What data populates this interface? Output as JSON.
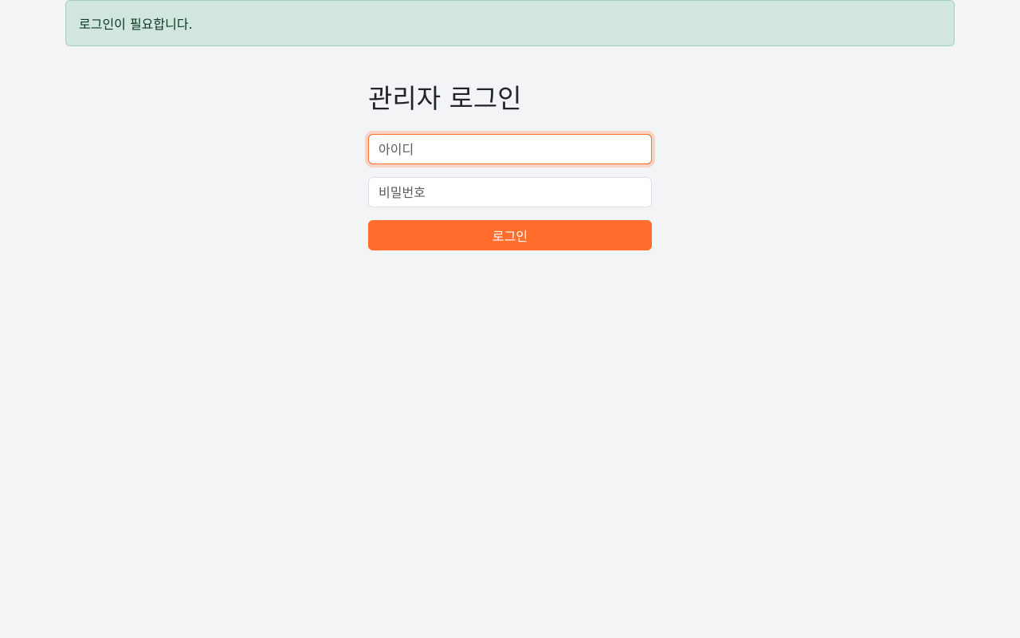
{
  "alert": {
    "message": "로그인이 필요합니다."
  },
  "login": {
    "title": "관리자 로그인",
    "username_placeholder": "아이디",
    "username_value": "",
    "password_placeholder": "비밀번호",
    "password_value": "",
    "submit_label": "로그인"
  },
  "colors": {
    "background": "#f3f4f6",
    "alert_bg": "#d1e7dd",
    "alert_text": "#0a3622",
    "accent": "#ff6e2c"
  }
}
